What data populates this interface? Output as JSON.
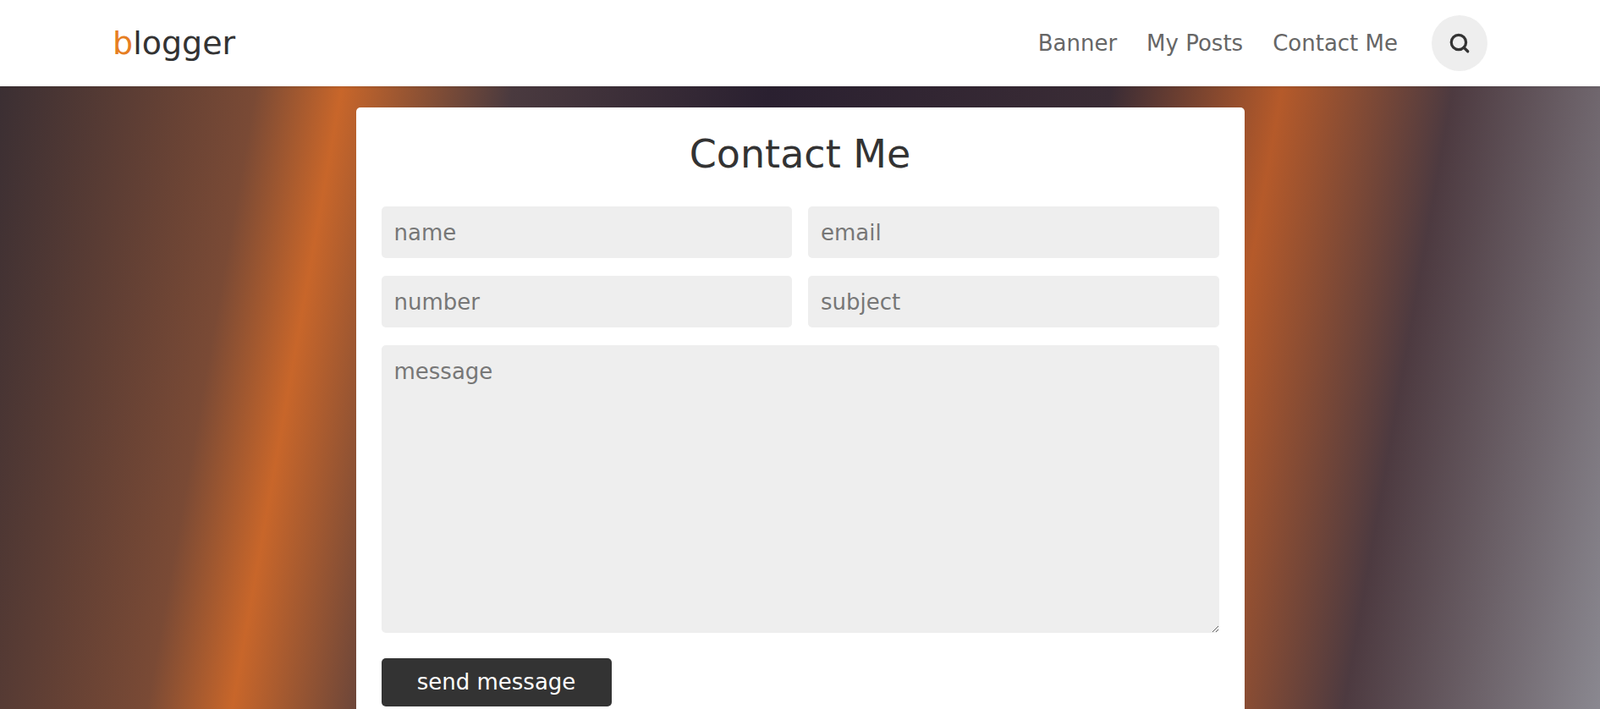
{
  "header": {
    "logo": {
      "accent": "b",
      "rest": "logger"
    },
    "nav": [
      {
        "label": "Banner"
      },
      {
        "label": "My Posts"
      },
      {
        "label": "Contact Me"
      }
    ]
  },
  "contact": {
    "title": "Contact Me",
    "fields": [
      {
        "placeholder": "name"
      },
      {
        "placeholder": "email"
      },
      {
        "placeholder": "number"
      },
      {
        "placeholder": "subject"
      }
    ],
    "message": {
      "placeholder": "message"
    },
    "button": "send message"
  }
}
